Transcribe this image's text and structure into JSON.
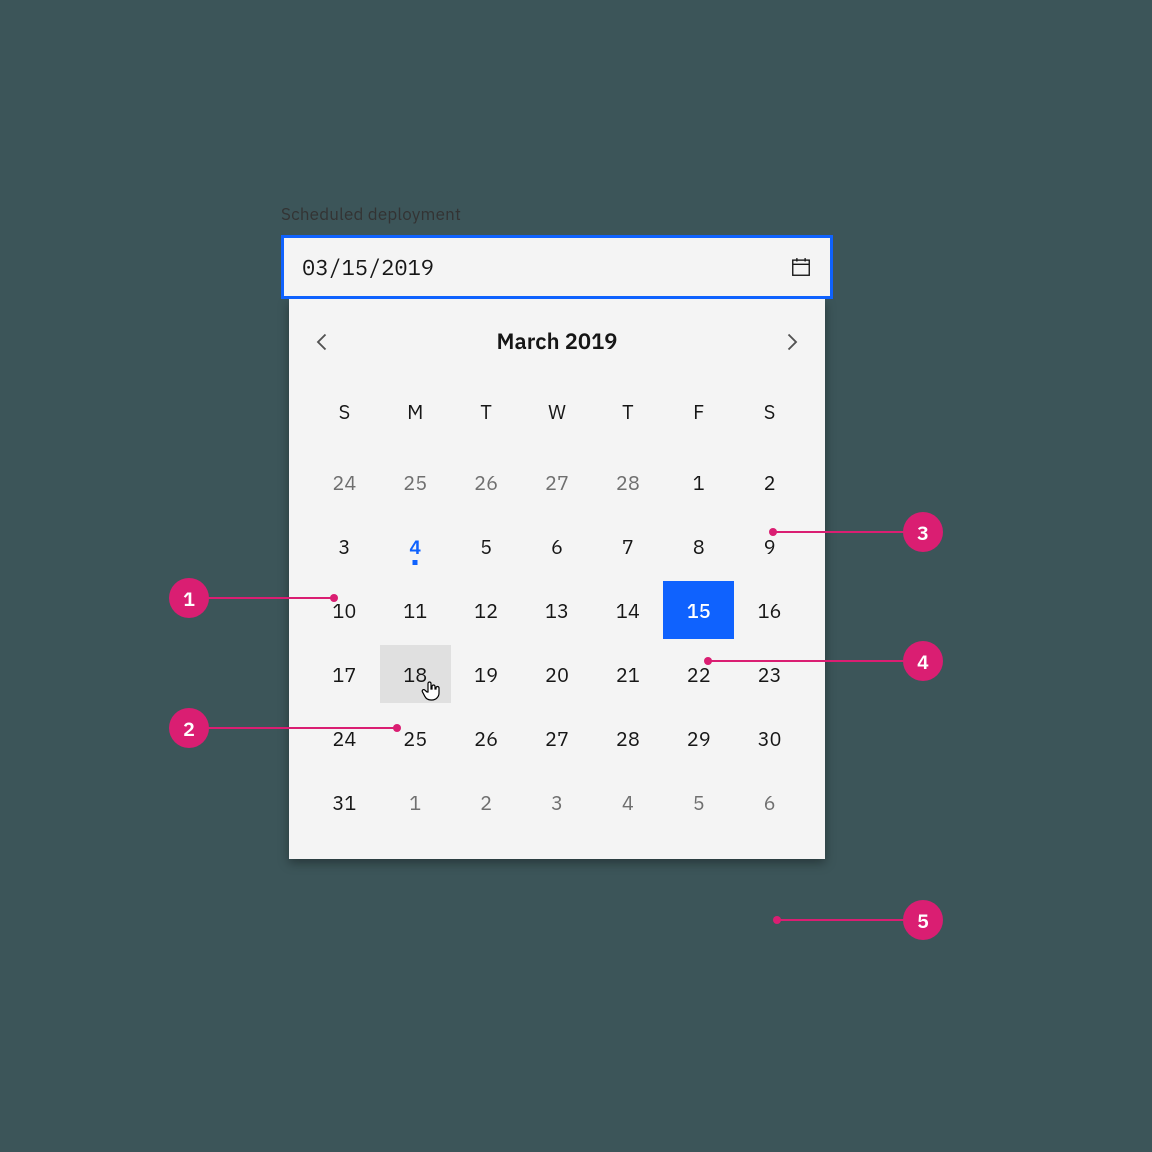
{
  "label": "Scheduled deployment",
  "input_value": "03/15/2019",
  "month_label": "March 2019",
  "accent": "#0f62fe",
  "dow": [
    "S",
    "M",
    "T",
    "W",
    "T",
    "F",
    "S"
  ],
  "weeks": [
    [
      {
        "n": 24,
        "o": true
      },
      {
        "n": 25,
        "o": true
      },
      {
        "n": 26,
        "o": true
      },
      {
        "n": 27,
        "o": true
      },
      {
        "n": 28,
        "o": true
      },
      {
        "n": 1
      },
      {
        "n": 2
      }
    ],
    [
      {
        "n": 3
      },
      {
        "n": 4,
        "today": true
      },
      {
        "n": 5
      },
      {
        "n": 6
      },
      {
        "n": 7
      },
      {
        "n": 8
      },
      {
        "n": 9
      }
    ],
    [
      {
        "n": 10
      },
      {
        "n": 11
      },
      {
        "n": 12
      },
      {
        "n": 13
      },
      {
        "n": 14
      },
      {
        "n": 15,
        "selected": true
      },
      {
        "n": 16
      }
    ],
    [
      {
        "n": 17
      },
      {
        "n": 18,
        "hover": true
      },
      {
        "n": 19
      },
      {
        "n": 20
      },
      {
        "n": 21
      },
      {
        "n": 22
      },
      {
        "n": 23
      }
    ],
    [
      {
        "n": 24
      },
      {
        "n": 25
      },
      {
        "n": 26
      },
      {
        "n": 27
      },
      {
        "n": 28
      },
      {
        "n": 29
      },
      {
        "n": 30
      }
    ],
    [
      {
        "n": 31
      },
      {
        "n": 1,
        "o": true
      },
      {
        "n": 2,
        "o": true
      },
      {
        "n": 3,
        "o": true
      },
      {
        "n": 4,
        "o": true
      },
      {
        "n": 5,
        "o": true
      },
      {
        "n": 6,
        "o": true
      }
    ]
  ],
  "annotations": {
    "1": "1",
    "2": "2",
    "3": "3",
    "4": "4",
    "5": "5"
  }
}
